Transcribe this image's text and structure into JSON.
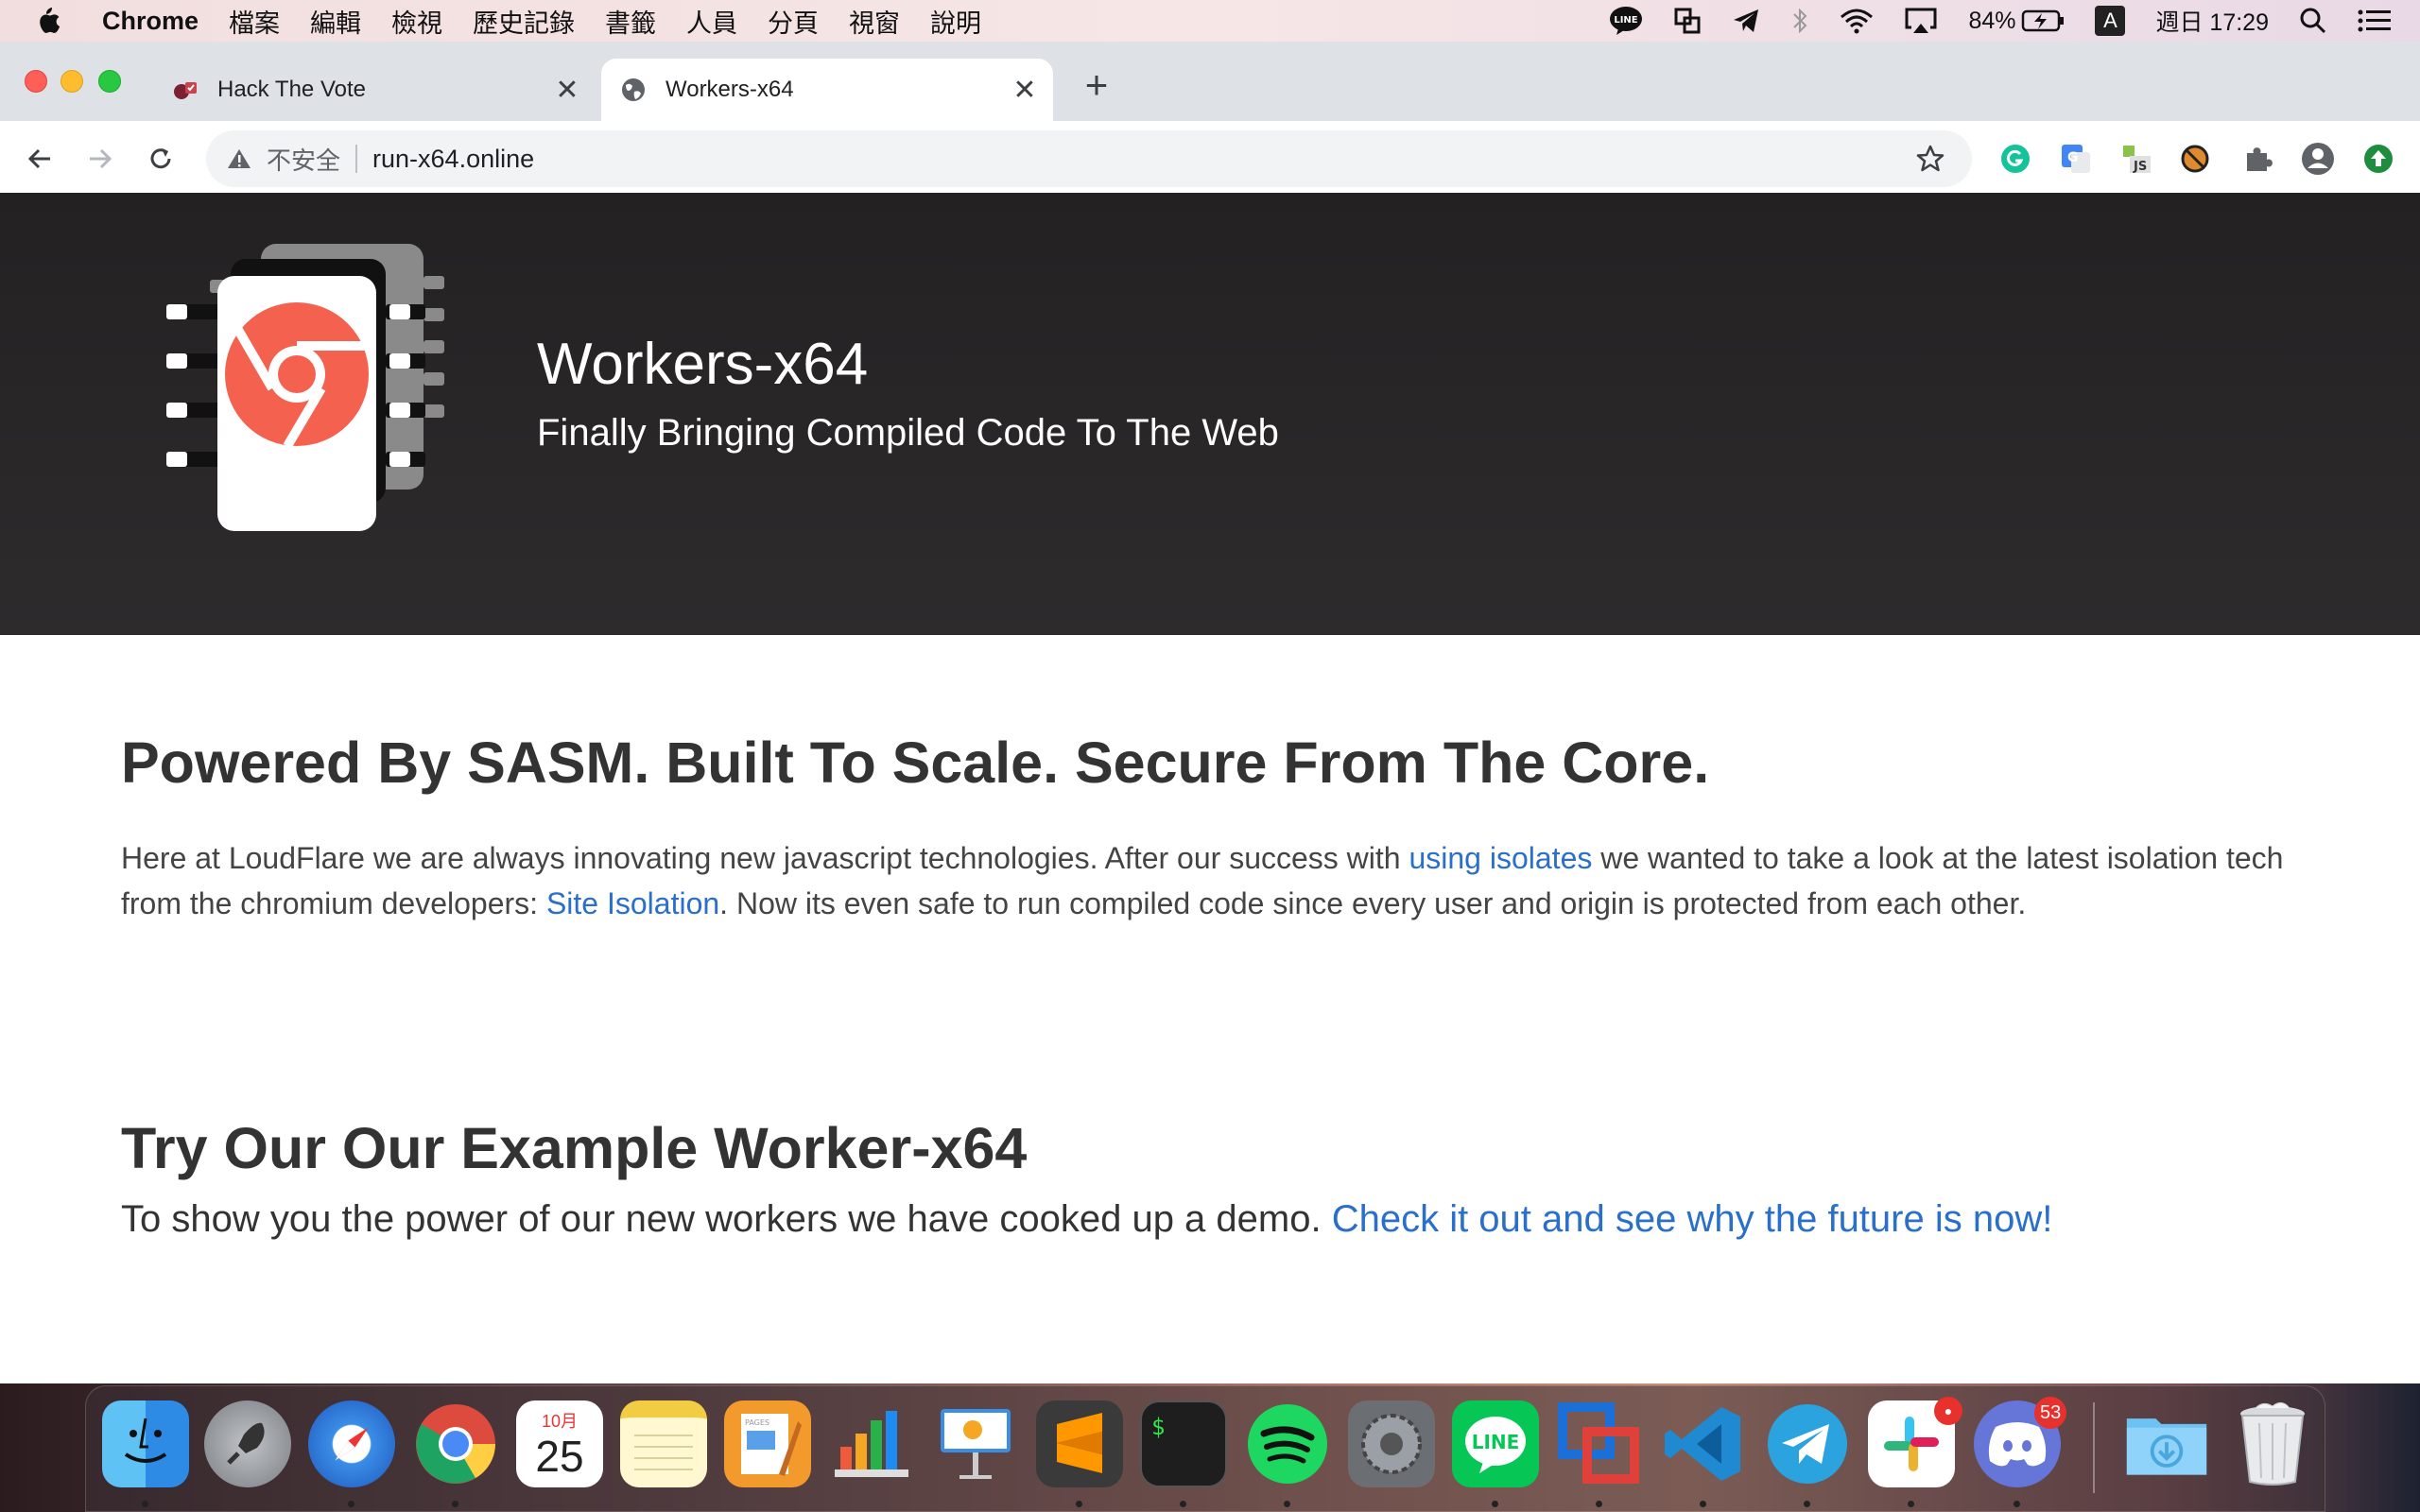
{
  "menubar": {
    "app_name": "Chrome",
    "menus": [
      "檔案",
      "編輯",
      "檢視",
      "歷史記錄",
      "書籤",
      "人員",
      "分頁",
      "視窗",
      "說明"
    ],
    "battery": "84%",
    "input_method": "A",
    "clock": "週日 17:29",
    "line_label": "LINE"
  },
  "tabs": [
    {
      "title": "Hack The Vote",
      "active": false
    },
    {
      "title": "Workers-x64",
      "active": true
    }
  ],
  "omnibox": {
    "security_label": "不安全",
    "url": "run-x64.online"
  },
  "hero": {
    "title": "Workers-x64",
    "subtitle": "Finally Bringing Compiled Code To The Web"
  },
  "section1": {
    "heading": "Powered By SASM. Built To Scale. Secure From The Core.",
    "p_part1": "Here at LoudFlare we are always innovating new javascript technologies. After our success with ",
    "link1": "using isolates",
    "p_part2": " we wanted to take a look at the latest isolation tech from the chromium developers: ",
    "link2": "Site Isolation",
    "p_part3": ". Now its even safe to run compiled code since every user and origin is protected from each other."
  },
  "section2": {
    "heading": "Try Our Our Example Worker-x64",
    "text": "To show you the power of our new workers we have cooked up a demo. ",
    "link": "Check it out and see why the future is now!"
  },
  "dock": {
    "calendar_month": "10月",
    "calendar_day": "25",
    "discord_badge": "53",
    "line_label": "LINE",
    "terminal_prompt": "$",
    "pages_label": "PAGES",
    "apps": [
      "Finder",
      "Launchpad",
      "Safari",
      "Google Chrome",
      "Calendar",
      "Notes",
      "Pages",
      "Numbers",
      "Keynote",
      "Sublime Text",
      "Terminal",
      "Spotify",
      "System Preferences",
      "LINE",
      "VMware Fusion",
      "Visual Studio Code",
      "Telegram",
      "Slack",
      "Discord",
      "Downloads",
      "Trash"
    ]
  },
  "colors": {
    "hero_bg": "#232122",
    "link": "#2a6fc9",
    "chrome_logo": "#f4614f",
    "tabstrip": "#dee1e6"
  }
}
